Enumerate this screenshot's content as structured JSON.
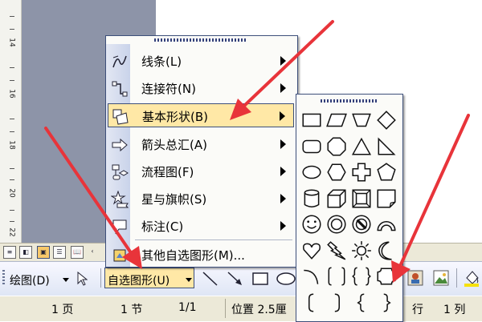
{
  "ruler": {
    "labels": [
      "14",
      "16",
      "18",
      "20",
      "22"
    ]
  },
  "drawing_toolbar": {
    "draw_label": "绘图(D)",
    "autoshapes_label": "自选图形(U)"
  },
  "status_bar": {
    "page": "1 页",
    "section": "1 节",
    "page_of": "1/1",
    "position": "位置 2.5厘",
    "line": "行",
    "column": "1 列"
  },
  "autoshapes_menu": {
    "items": [
      {
        "label": "线条(L)",
        "icon": "lines-icon",
        "has_submenu": true
      },
      {
        "label": "连接符(N)",
        "icon": "connectors-icon",
        "has_submenu": true
      },
      {
        "label": "基本形状(B)",
        "icon": "basic-shapes-icon",
        "has_submenu": true,
        "highlighted": true
      },
      {
        "label": "箭头总汇(A)",
        "icon": "block-arrows-icon",
        "has_submenu": true
      },
      {
        "label": "流程图(F)",
        "icon": "flowchart-icon",
        "has_submenu": true
      },
      {
        "label": "星与旗帜(S)",
        "icon": "stars-banners-icon",
        "has_submenu": true
      },
      {
        "label": "标注(C)",
        "icon": "callouts-icon",
        "has_submenu": true
      },
      {
        "label": "其他自选图形(M)...",
        "icon": "more-autoshapes-icon",
        "has_submenu": false
      }
    ]
  },
  "basic_shapes_submenu": {
    "shapes": [
      "rectangle",
      "parallelogram",
      "trapezoid",
      "diamond",
      "rounded-rectangle",
      "octagon",
      "triangle",
      "right-triangle",
      "ellipse",
      "hexagon",
      "cross",
      "pentagon",
      "can",
      "cube",
      "bevel",
      "folded-corner",
      "smiley-face",
      "donut",
      "no-symbol",
      "block-arc",
      "heart",
      "lightning-bolt",
      "sun",
      "moon",
      "arc",
      "double-bracket",
      "double-brace",
      "plaque",
      "left-bracket",
      "right-bracket",
      "left-brace",
      "right-brace"
    ]
  },
  "colors": {
    "highlight": "#ffe8a6",
    "menu_border": "#3d4f7a",
    "arrow": "#e8343a"
  }
}
